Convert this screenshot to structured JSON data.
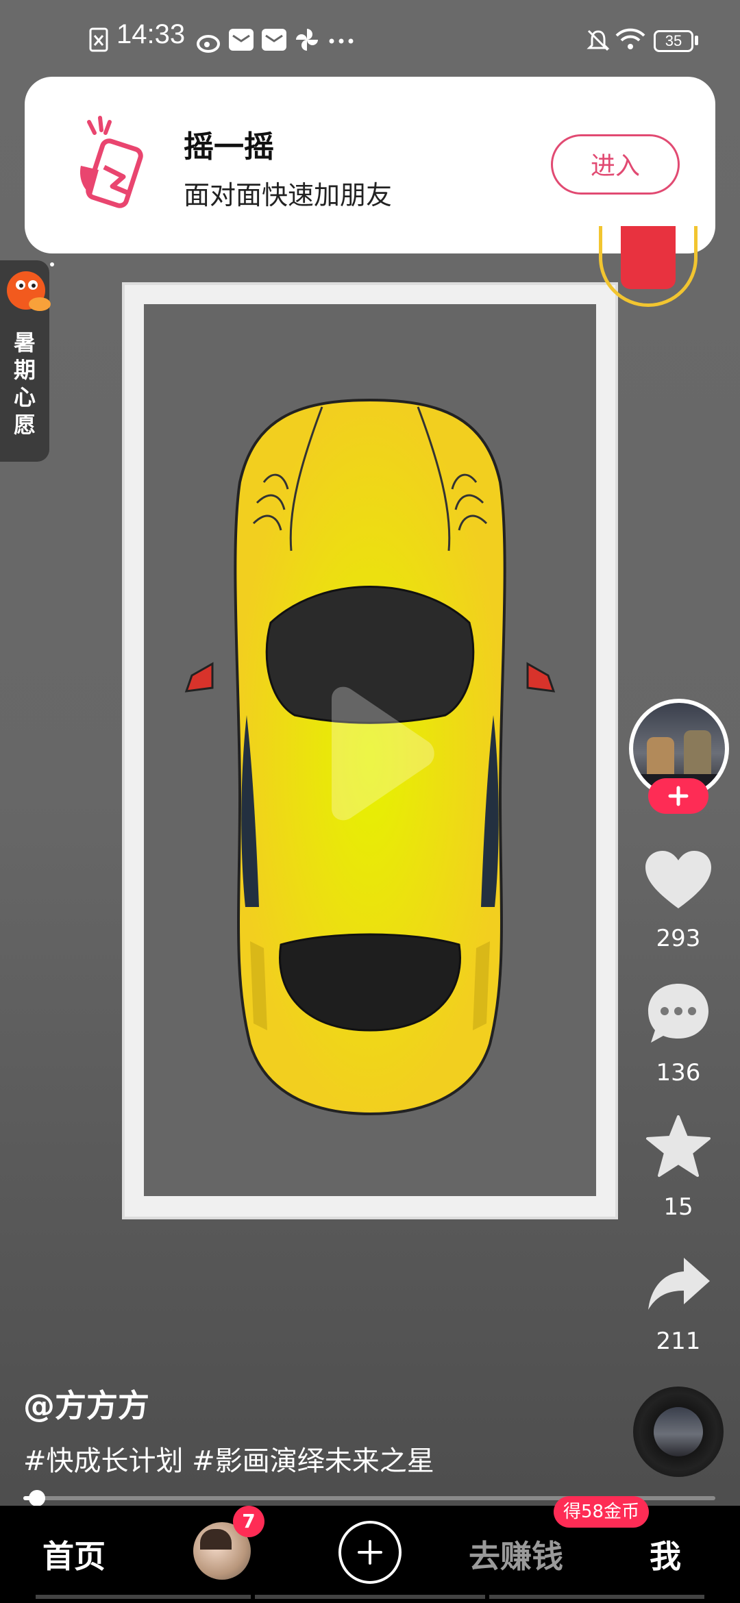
{
  "status_bar": {
    "time": "14:33",
    "battery": "35"
  },
  "notification": {
    "title": "摇一摇",
    "subtitle": "面对面快速加朋友",
    "button": "进入"
  },
  "side_banner": {
    "label": "暑期心愿"
  },
  "actions": {
    "likes": "293",
    "comments": "136",
    "favorites": "15",
    "shares": "211"
  },
  "video": {
    "author": "@方方方",
    "tags": "#快成长计划 #影画演绎未来之星",
    "progress": 0.02
  },
  "nav": {
    "home": "首页",
    "friends_badge": "7",
    "earn": "去赚钱",
    "earn_badge": "得58金币",
    "me": "我"
  },
  "colors": {
    "accent": "#fe2c55",
    "notif_button": "#e14a72",
    "car": "#f2cf1f"
  }
}
